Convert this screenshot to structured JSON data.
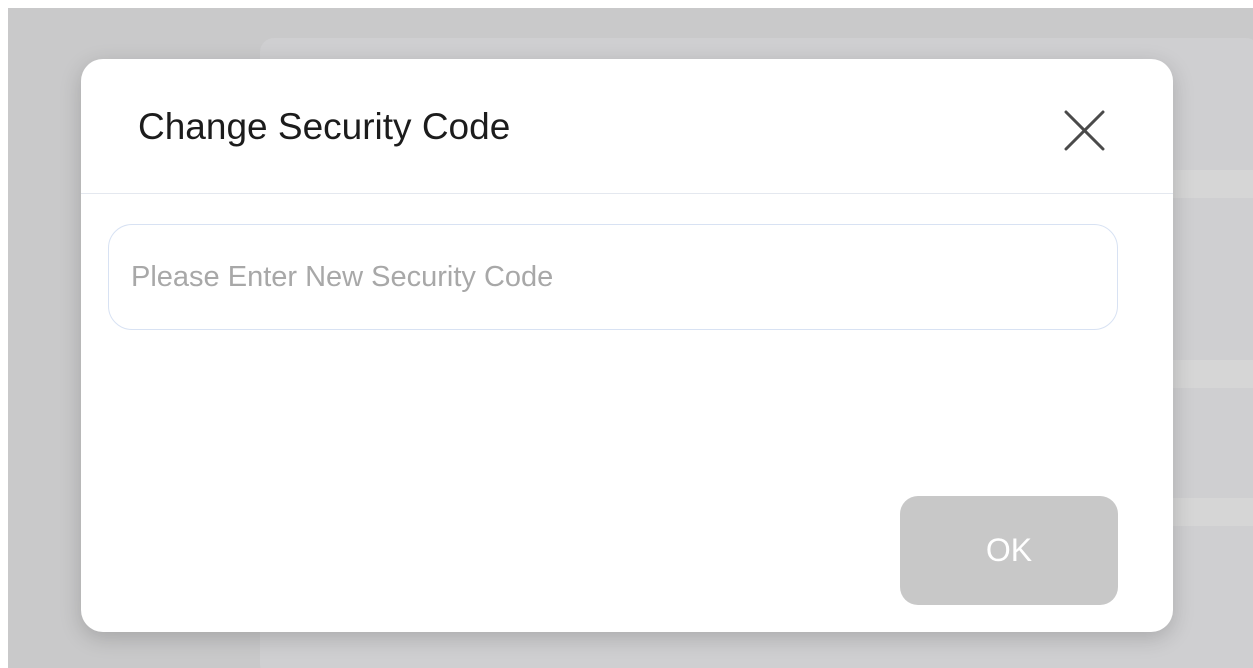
{
  "dialog": {
    "title": "Change Security Code",
    "close_icon": "close-icon",
    "input": {
      "value": "",
      "placeholder": "Please Enter New Security Code"
    },
    "ok_label": "OK",
    "ok_state": "disabled"
  },
  "colors": {
    "backdrop": "#c9c9ca",
    "dialog_background": "#ffffff",
    "input_border": "#d8e2f3",
    "ok_button_disabled": "#c8c8c8",
    "ok_text": "#ffffff",
    "title_text": "#1c1c1c"
  }
}
